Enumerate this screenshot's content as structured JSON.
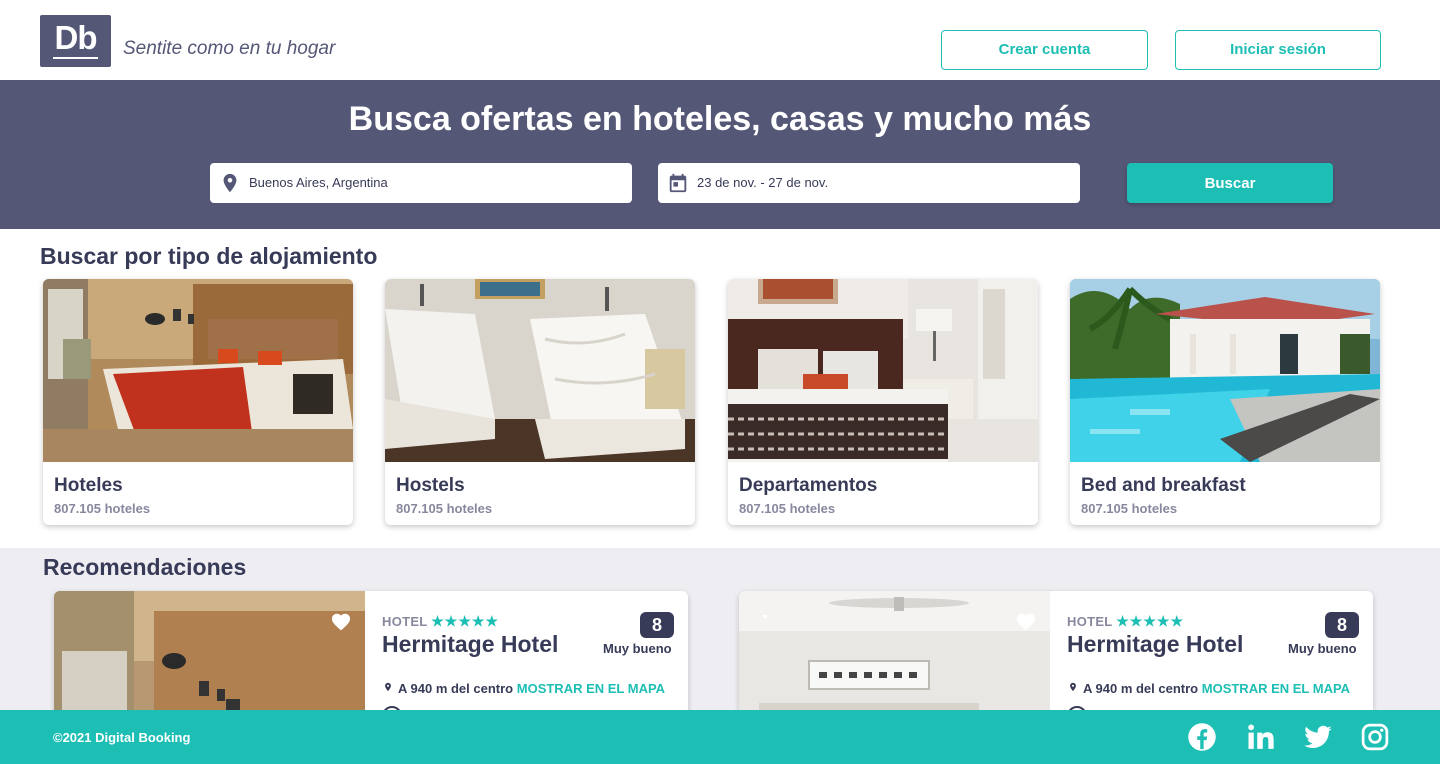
{
  "header": {
    "logo_text": "Db",
    "slogan": "Sentite como en tu hogar",
    "create_account": "Crear cuenta",
    "login": "Iniciar sesión"
  },
  "search": {
    "title": "Busca ofertas en hoteles, casas y mucho más",
    "location_value": "Buenos Aires, Argentina",
    "dates_value": "23 de nov. - 27 de nov.",
    "button": "Buscar"
  },
  "categories": {
    "title": "Buscar por tipo de alojamiento",
    "items": [
      {
        "name": "Hoteles",
        "count": "807.105 hoteles"
      },
      {
        "name": "Hostels",
        "count": "807.105 hoteles"
      },
      {
        "name": "Departamentos",
        "count": "807.105 hoteles"
      },
      {
        "name": "Bed and breakfast",
        "count": "807.105 hoteles"
      }
    ]
  },
  "recommendations": {
    "title": "Recomendaciones",
    "items": [
      {
        "category": "HOTEL",
        "stars": "★★★★★",
        "name": "Hermitage Hotel",
        "score": "8",
        "score_label": "Muy bueno",
        "location": "A 940 m del centro",
        "map_link": "MOSTRAR EN EL MAPA"
      },
      {
        "category": "HOTEL",
        "stars": "★★★★★",
        "name": "Hermitage Hotel",
        "score": "8",
        "score_label": "Muy bueno",
        "location": "A 940 m del centro",
        "map_link": "MOSTRAR EN EL MAPA"
      }
    ]
  },
  "footer": {
    "copyright": "©2021 Digital Booking"
  },
  "colors": {
    "primary": "#1dbeb4",
    "secondary": "#545776",
    "dark": "#383b58",
    "muted": "#87889e",
    "light_bg": "#eeeef2"
  },
  "icons": [
    "location-pin-icon",
    "calendar-icon",
    "heart-icon",
    "facebook-icon",
    "linkedin-icon",
    "twitter-icon",
    "instagram-icon"
  ]
}
